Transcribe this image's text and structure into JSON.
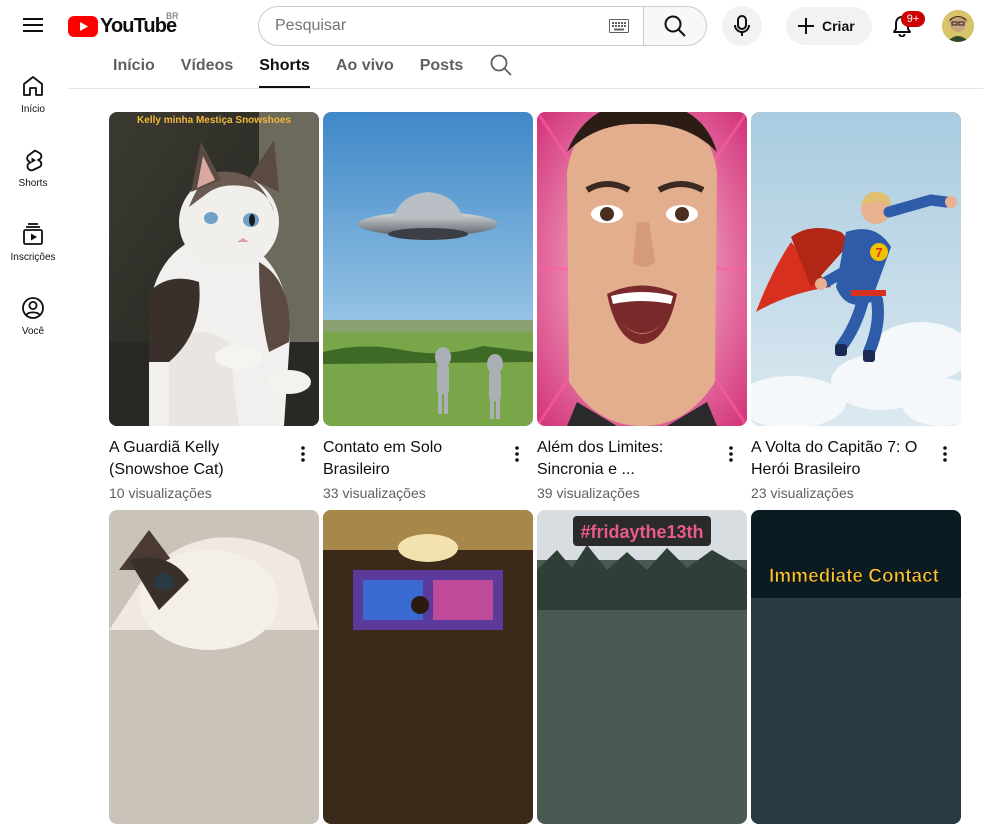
{
  "header": {
    "logo_text": "YouTube",
    "country_code": "BR",
    "search_placeholder": "Pesquisar",
    "create_label": "Criar",
    "notifications_badge": "9+"
  },
  "rail": [
    {
      "label": "Início",
      "icon": "home-icon"
    },
    {
      "label": "Shorts",
      "icon": "shorts-icon"
    },
    {
      "label": "Inscrições",
      "icon": "subscriptions-icon"
    },
    {
      "label": "Você",
      "icon": "you-icon"
    }
  ],
  "tabs": [
    {
      "label": "Início",
      "active": false
    },
    {
      "label": "Vídeos",
      "active": false
    },
    {
      "label": "Shorts",
      "active": true
    },
    {
      "label": "Ao vivo",
      "active": false
    },
    {
      "label": "Posts",
      "active": false
    }
  ],
  "shorts": [
    {
      "title": "A Guardiã Kelly (Snowshoe Cat)",
      "views": "10 visualizações",
      "overlay": "Kelly minha Mestiça Snowshoes"
    },
    {
      "title": "Contato em Solo Brasileiro",
      "views": "33 visualizações",
      "overlay": ""
    },
    {
      "title": "Além dos Limites: Sincronia e ...",
      "views": "39 visualizações",
      "overlay": ""
    },
    {
      "title": "A Volta do Capitão 7: O Herói Brasileiro",
      "views": "23 visualizações",
      "overlay": ""
    }
  ],
  "shorts_row2": [
    {
      "overlay": ""
    },
    {
      "overlay": ""
    },
    {
      "overlay": "#fridaythe13th"
    },
    {
      "overlay": "Immediate Contact"
    }
  ],
  "colors": {
    "brand_red": "#ff0000",
    "badge_red": "#cc0000",
    "text_primary": "#0f0f0f",
    "text_secondary": "#606060"
  }
}
